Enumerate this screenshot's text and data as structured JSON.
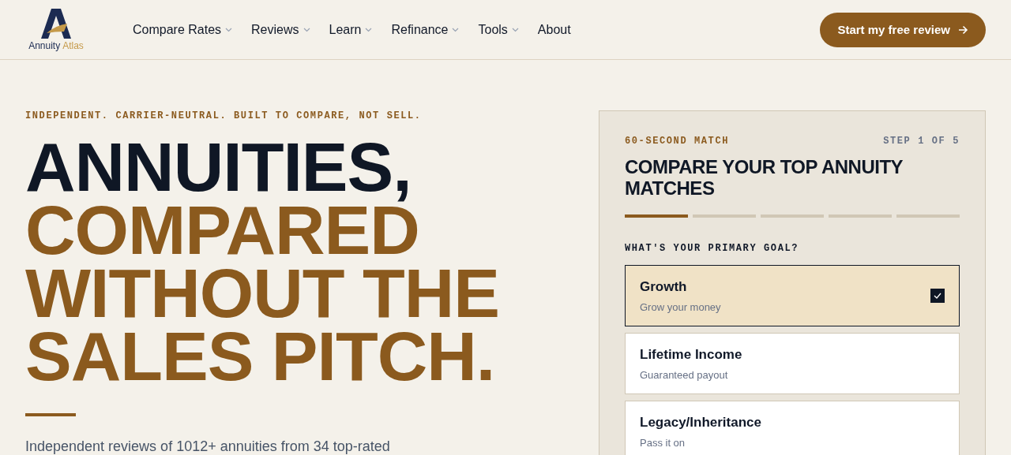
{
  "logo": {
    "word_1": "Annuity",
    "word_2": "Atlas"
  },
  "nav": [
    {
      "label": "Compare Rates",
      "has_menu": true
    },
    {
      "label": "Reviews",
      "has_menu": true
    },
    {
      "label": "Learn",
      "has_menu": true
    },
    {
      "label": "Refinance",
      "has_menu": true
    },
    {
      "label": "Tools",
      "has_menu": true
    },
    {
      "label": "About",
      "has_menu": false
    }
  ],
  "cta": {
    "label": "Start my free review"
  },
  "hero": {
    "eyebrow": "INDEPENDENT. CARRIER-NEUTRAL. BUILT TO COMPARE, NOT SELL.",
    "headline": [
      {
        "text": "ANNUITIES,",
        "accent": false
      },
      {
        "text": "COMPARED",
        "accent": true
      },
      {
        "text": "WITHOUT THE",
        "accent": true
      },
      {
        "text": "SALES PITCH.",
        "accent": true
      }
    ],
    "lede": "Independent reviews of 1012+ annuities from 34 top-rated"
  },
  "quiz": {
    "eyebrow": "60-SECOND MATCH",
    "step": "STEP 1 OF 5",
    "title": "COMPARE YOUR TOP ANNUITY MATCHES",
    "progress": [
      {
        "filled": true
      },
      {
        "filled": false
      },
      {
        "filled": false
      },
      {
        "filled": false
      },
      {
        "filled": false
      }
    ],
    "question": "WHAT'S YOUR PRIMARY GOAL?",
    "options": [
      {
        "title": "Growth",
        "subtitle": "Grow your money",
        "selected": true
      },
      {
        "title": "Lifetime Income",
        "subtitle": "Guaranteed payout",
        "selected": false
      },
      {
        "title": "Legacy/Inheritance",
        "subtitle": "Pass it on",
        "selected": false
      }
    ]
  }
}
